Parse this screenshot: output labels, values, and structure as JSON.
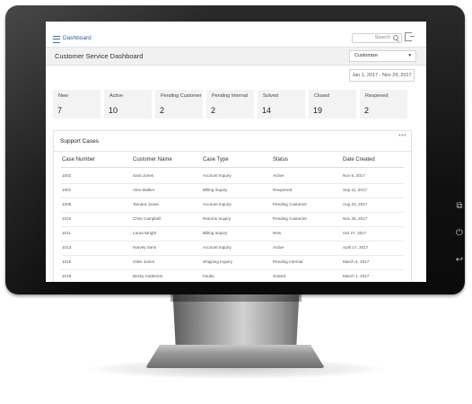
{
  "nav": {
    "dashboard_label": "Dashboard"
  },
  "search": {
    "placeholder": "Search"
  },
  "header": {
    "title": "Customer Service Dashboard",
    "customize_label": "Customize"
  },
  "date_range": "Jan 1, 2017 - Nov 29, 2017",
  "kpis": [
    {
      "label": "New",
      "value": "7"
    },
    {
      "label": "Active",
      "value": "10"
    },
    {
      "label": "Pending Customer",
      "value": "2"
    },
    {
      "label": "Pending Internal",
      "value": "2"
    },
    {
      "label": "Solved",
      "value": "14"
    },
    {
      "label": "Closed",
      "value": "19"
    },
    {
      "label": "Reopened",
      "value": "2"
    }
  ],
  "table": {
    "title": "Support Cases",
    "columns": [
      "Case Number",
      "Customer Name",
      "Case Type",
      "Status",
      "Date Created"
    ],
    "rows": [
      [
        "1002",
        "Sara Jones",
        "Account Inquiry",
        "Active",
        "Nov 5, 2017"
      ],
      [
        "1001",
        "Alex Walker",
        "Billing Inquiry",
        "Reopened",
        "Sep 11, 2017"
      ],
      [
        "1009",
        "Tamara Jones",
        "Account Inquiry",
        "Pending Customer",
        "Aug 23, 2017"
      ],
      [
        "1010",
        "Chris Campbell",
        "Returns Inquiry",
        "Pending Customer",
        "Nov 26, 2017"
      ],
      [
        "1011",
        "Laura Wright",
        "Billing Inquiry",
        "New",
        "Oct 27, 2017"
      ],
      [
        "1013",
        "Harvey Sims",
        "Account Inquiry",
        "Active",
        "April 17, 2017"
      ],
      [
        "1018",
        "Giles Jones",
        "Shipping Inquiry",
        "Pending Internal",
        "March 4, 2017"
      ],
      [
        "1019",
        "Becky Anderson",
        "Faulty",
        "Solved",
        "March 1, 2017"
      ]
    ]
  },
  "icons": {
    "menu": "hamburger-icon",
    "search": "search-icon",
    "signout": "signout-icon",
    "more": "more-icon",
    "monitor_buttons": [
      "window-icon",
      "power-icon",
      "back-icon"
    ]
  },
  "colors": {
    "accent": "#2a5aa0",
    "card_bg": "#f3f3f3",
    "bezel": "#111111"
  }
}
